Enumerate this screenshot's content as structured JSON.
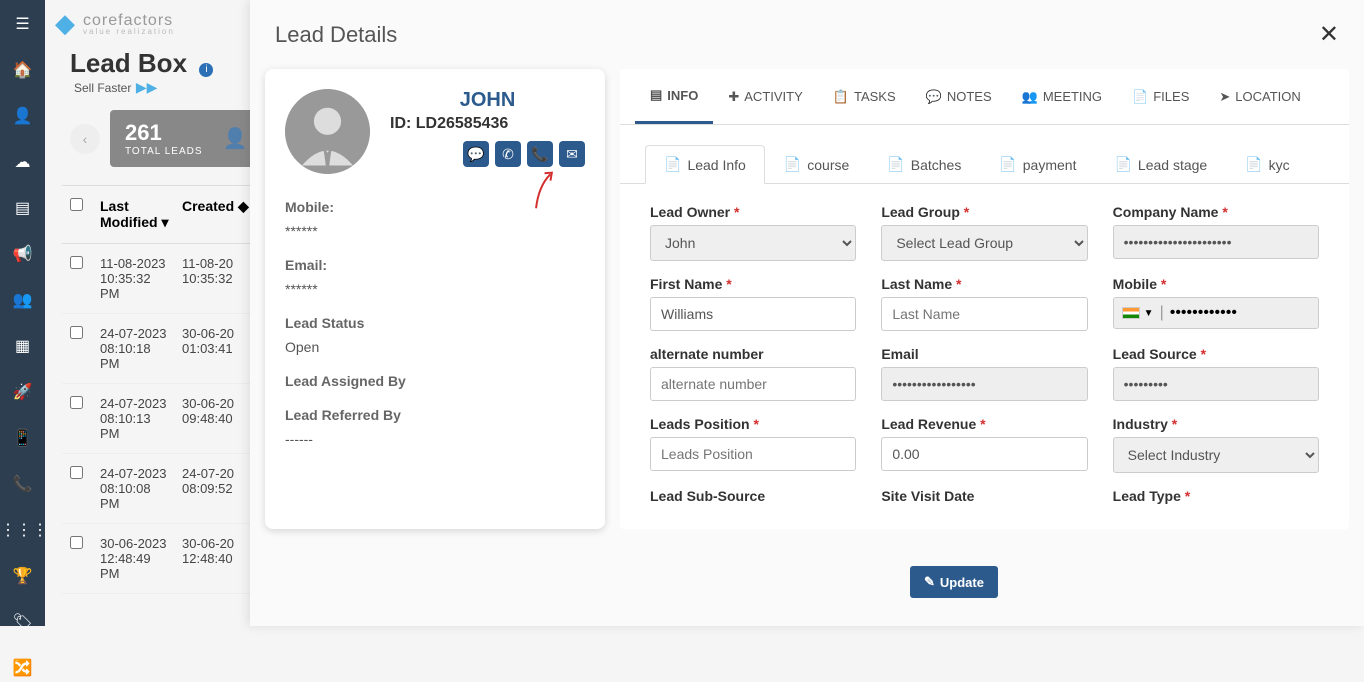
{
  "brand": {
    "name": "corefactors",
    "tagline": "value realization"
  },
  "leadbox": {
    "title": "Lead Box",
    "subtitle": "Sell Faster"
  },
  "stats": {
    "count": "261",
    "label": "TOTAL LEADS"
  },
  "table": {
    "headers": {
      "modified": "Last Modified",
      "created": "Created"
    },
    "rows": [
      {
        "modified": "11-08-2023",
        "modified_time": "10:35:32 PM",
        "created": "11-08-20",
        "created_time": "10:35:32"
      },
      {
        "modified": "24-07-2023",
        "modified_time": "08:10:18 PM",
        "created": "30-06-20",
        "created_time": "01:03:41"
      },
      {
        "modified": "24-07-2023",
        "modified_time": "08:10:13 PM",
        "created": "30-06-20",
        "created_time": "09:48:40"
      },
      {
        "modified": "24-07-2023",
        "modified_time": "08:10:08 PM",
        "created": "24-07-20",
        "created_time": "08:09:52"
      },
      {
        "modified": "30-06-2023",
        "modified_time": "12:48:49 PM",
        "created": "30-06-20",
        "created_time": "12:48:40"
      }
    ]
  },
  "modal": {
    "title": "Lead Details",
    "lead": {
      "name": "JOHN",
      "id_label": "ID: LD26585436",
      "mobile_label": "Mobile:",
      "mobile": "******",
      "email_label": "Email:",
      "email": "******",
      "status_label": "Lead Status",
      "status": "Open",
      "assigned_label": "Lead Assigned By",
      "assigned": "",
      "referred_label": "Lead Referred By",
      "referred": "------"
    },
    "tabs_primary": [
      "INFO",
      "ACTIVITY",
      "TASKS",
      "NOTES",
      "MEETING",
      "FILES",
      "LOCATION"
    ],
    "tabs_secondary": [
      "Lead Info",
      "course",
      "Batches",
      "payment",
      "Lead stage",
      "kyc"
    ],
    "form": {
      "lead_owner": {
        "label": "Lead Owner",
        "value": "John"
      },
      "lead_group": {
        "label": "Lead Group",
        "value": "Select Lead Group"
      },
      "company": {
        "label": "Company Name",
        "value": "••••••••••••••••••••••"
      },
      "first_name": {
        "label": "First Name",
        "value": "Williams"
      },
      "last_name": {
        "label": "Last Name",
        "placeholder": "Last Name"
      },
      "mobile": {
        "label": "Mobile",
        "value": "••••••••••••"
      },
      "alt_number": {
        "label": "alternate number",
        "placeholder": "alternate number"
      },
      "email_f": {
        "label": "Email",
        "value": "•••••••••••••••••"
      },
      "lead_source": {
        "label": "Lead Source",
        "value": "•••••••••"
      },
      "leads_position": {
        "label": "Leads Position",
        "placeholder": "Leads Position"
      },
      "lead_revenue": {
        "label": "Lead Revenue",
        "value": "0.00"
      },
      "industry": {
        "label": "Industry",
        "value": "Select Industry"
      },
      "sub_source": {
        "label": "Lead Sub-Source"
      },
      "site_visit": {
        "label": "Site Visit Date"
      },
      "lead_type": {
        "label": "Lead Type"
      }
    },
    "update_btn": "Update"
  }
}
